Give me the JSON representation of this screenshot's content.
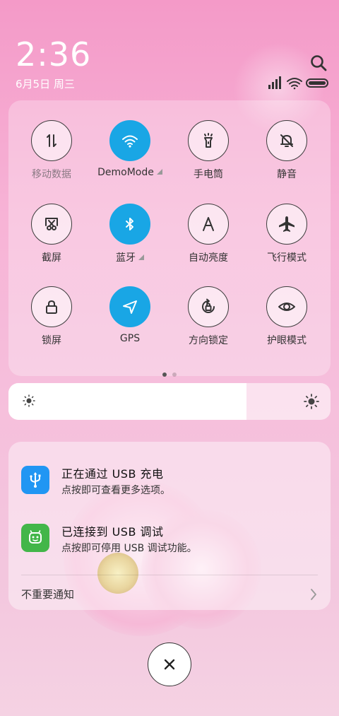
{
  "status": {
    "time": "2:36",
    "date": "6月5日 周三"
  },
  "toggles": [
    {
      "label": "移动数据",
      "icon": "mobile-data-icon",
      "on": false,
      "dim": true,
      "has_menu": false
    },
    {
      "label": "DemoMode",
      "icon": "wifi-icon",
      "on": true,
      "dim": false,
      "has_menu": true
    },
    {
      "label": "手电筒",
      "icon": "flashlight-icon",
      "on": false,
      "dim": false,
      "has_menu": false
    },
    {
      "label": "静音",
      "icon": "mute-bell-icon",
      "on": false,
      "dim": false,
      "has_menu": false
    },
    {
      "label": "截屏",
      "icon": "screenshot-icon",
      "on": false,
      "dim": false,
      "has_menu": false
    },
    {
      "label": "蓝牙",
      "icon": "bluetooth-icon",
      "on": true,
      "dim": false,
      "has_menu": true
    },
    {
      "label": "自动亮度",
      "icon": "auto-brightness-icon",
      "on": false,
      "dim": false,
      "has_menu": false
    },
    {
      "label": "飞行模式",
      "icon": "airplane-icon",
      "on": false,
      "dim": false,
      "has_menu": false
    },
    {
      "label": "锁屏",
      "icon": "lock-icon",
      "on": false,
      "dim": false,
      "has_menu": false
    },
    {
      "label": "GPS",
      "icon": "gps-icon",
      "on": true,
      "dim": false,
      "has_menu": false
    },
    {
      "label": "方向锁定",
      "icon": "rotation-lock-icon",
      "on": false,
      "dim": false,
      "has_menu": false
    },
    {
      "label": "护眼模式",
      "icon": "eye-icon",
      "on": false,
      "dim": false,
      "has_menu": false
    }
  ],
  "page_indicator": {
    "pages": 2,
    "current": 0
  },
  "brightness": {
    "level": 0.74
  },
  "notifications": [
    {
      "title": "正在通过 USB 充电",
      "text": "点按即可查看更多选项。",
      "icon": "usb-icon",
      "color": "#2196f3"
    },
    {
      "title": "已连接到 USB 调试",
      "text": "点按即可停用 USB 调试功能。",
      "icon": "android-icon",
      "color": "#43b649"
    }
  ],
  "unimportant_label": "不重要通知",
  "colors": {
    "accent": "#19a6e5"
  }
}
